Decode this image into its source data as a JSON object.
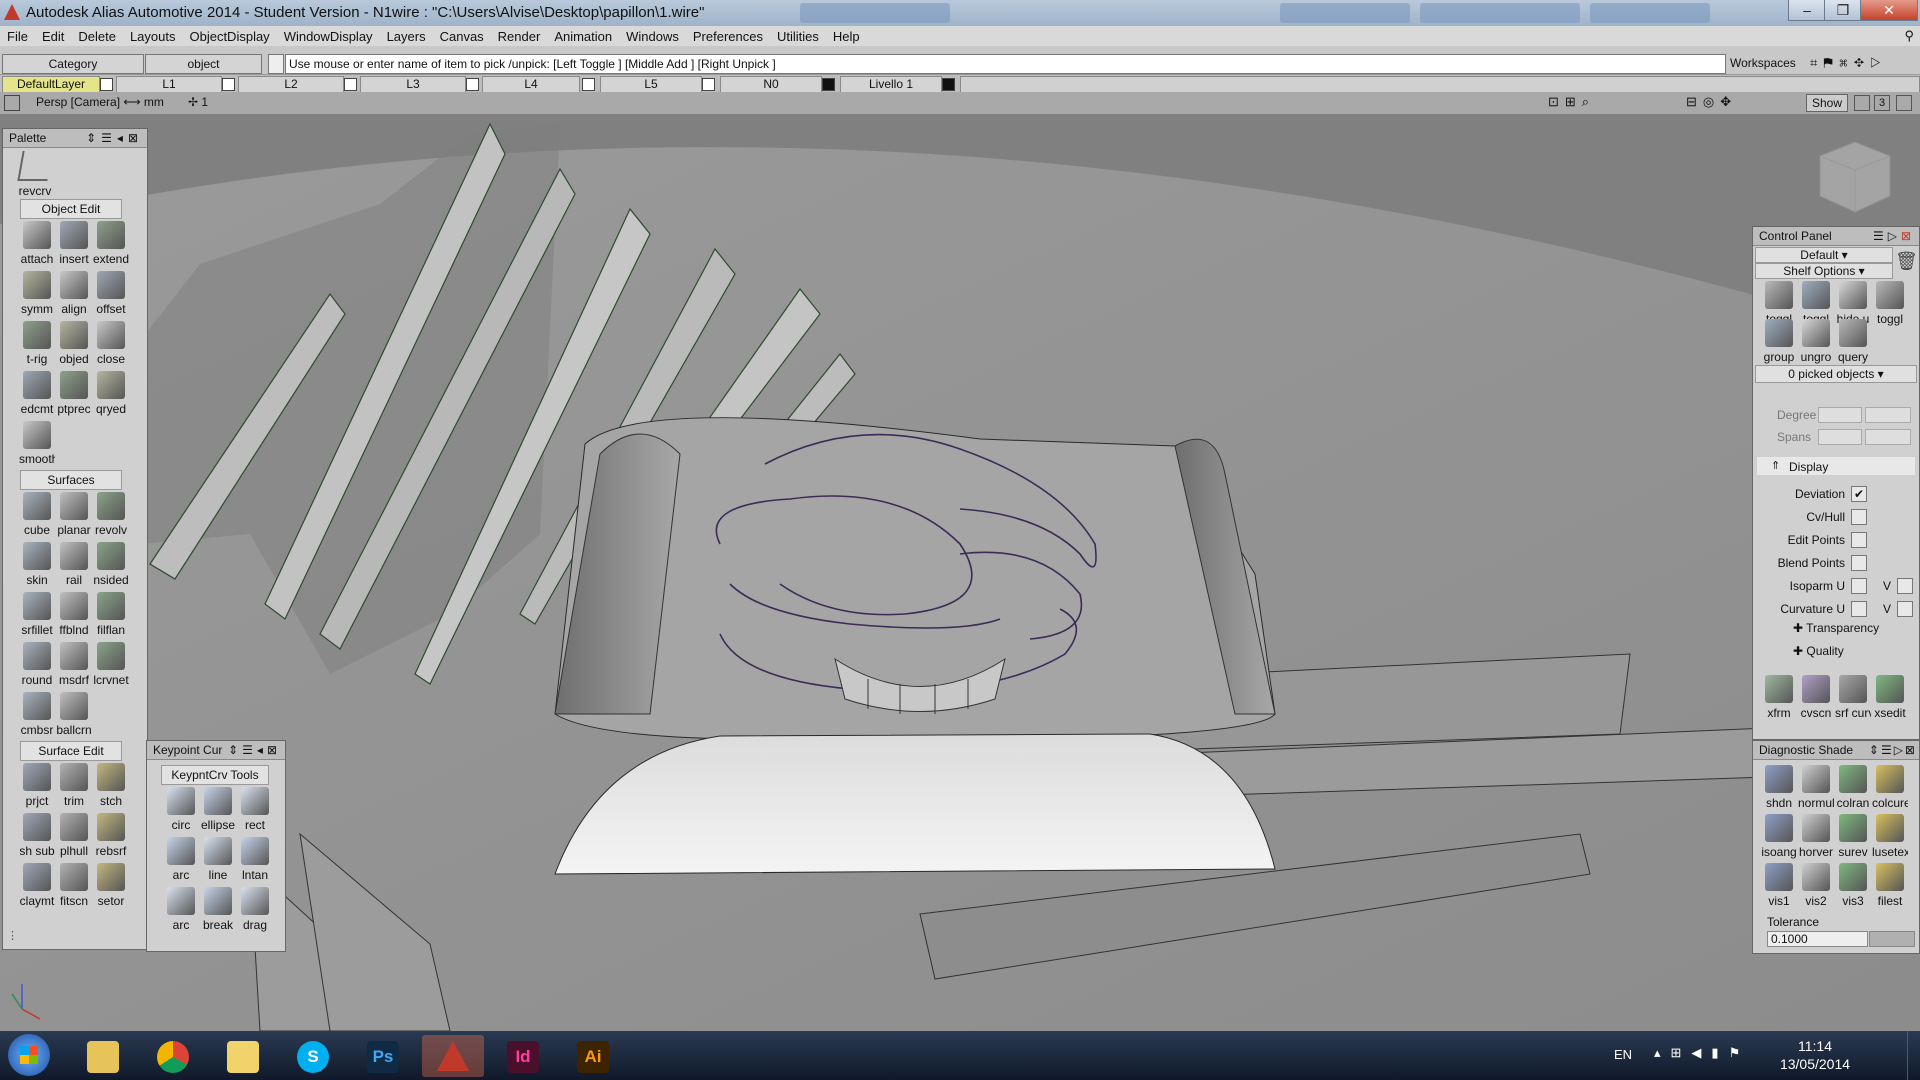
{
  "window": {
    "title": "Autodesk Alias Automotive 2014   - Student Version   - N1wire : \"C:\\Users\\Alvise\\Desktop\\papillon\\1.wire\""
  },
  "menu": [
    "File",
    "Edit",
    "Delete",
    "Layouts",
    "ObjectDisplay",
    "WindowDisplay",
    "Layers",
    "Canvas",
    "Render",
    "Animation",
    "Windows",
    "Preferences",
    "Utilities",
    "Help"
  ],
  "pickbar": {
    "category": "Category",
    "object": "object",
    "prompt": "Use mouse or enter name of item to pick /unpick: [Left Toggle ] [Middle Add ] [Right Unpick ]",
    "workspaces": "Workspaces"
  },
  "layers": [
    "DefaultLayer",
    "L1",
    "L2",
    "L3",
    "L4",
    "L5",
    "N0",
    "Livello 1"
  ],
  "viewbar": {
    "camera": "Persp [Camera] ⟷ mm",
    "grid": "✢ 1",
    "show": "Show",
    "three": "3"
  },
  "palette": {
    "title": "Palette",
    "top_tool": "revcrv",
    "sections": {
      "object_edit": "Object Edit",
      "surfaces": "Surfaces",
      "surface_edit": "Surface Edit"
    },
    "object_edit_tools": [
      "attach",
      "insert",
      "extend",
      "symm",
      "align",
      "offset",
      "t-rig",
      "objed",
      "close",
      "edcmt",
      "ptprec",
      "qryed",
      "smooth"
    ],
    "surfaces_tools": [
      "cube",
      "planar",
      "revolv",
      "skin",
      "rail",
      "nsided",
      "srfillet",
      "ffblnd",
      "filflan",
      "round",
      "msdrf",
      "lcrvnet",
      "cmbsr",
      "ballcrn"
    ],
    "surface_edit_tools": [
      "prjct",
      "trim",
      "stch",
      "sh sub",
      "plhull",
      "rebsrf",
      "claymt",
      "fitscn",
      "setor"
    ]
  },
  "keypoint": {
    "title": "Keypoint Cur",
    "tab": "KeypntCrv Tools",
    "tools": [
      "circ",
      "ellipse",
      "rect",
      "arc",
      "line",
      "lntan",
      "arc",
      "break",
      "drag"
    ]
  },
  "control_panel": {
    "title": "Control Panel",
    "preset": "Default",
    "shelf_options": "Shelf Options",
    "shelf_tools": [
      "toggl",
      "toggl",
      "hide u",
      "toggl",
      "group",
      "ungro",
      "query"
    ],
    "picked": "0 picked objects",
    "degree_label": "Degree",
    "spans_label": "Spans",
    "display_section": "Display",
    "options": [
      {
        "label": "Deviation",
        "checked": true
      },
      {
        "label": "Cv/Hull",
        "checked": false
      },
      {
        "label": "Edit Points",
        "checked": false
      },
      {
        "label": "Blend Points",
        "checked": false
      },
      {
        "label": "Isoparm U",
        "checked": false
      },
      {
        "label": "Curvature U",
        "checked": false
      }
    ],
    "v_label": "V",
    "transparency": "Transparency",
    "quality": "Quality",
    "bottom_tools": [
      "xfrm",
      "cvscn",
      "srf curva",
      "xsedit"
    ]
  },
  "diagnostic": {
    "title": "Diagnostic Shade",
    "tools": [
      "shdn",
      "normul",
      "colran",
      "colcurev",
      "isoang",
      "horver",
      "surev",
      "lusetex",
      "vis1",
      "vis2",
      "vis3",
      "filest"
    ],
    "tolerance_label": "Tolerance",
    "tolerance_value": "0.1000"
  },
  "taskbar": {
    "apps": [
      "Explorer",
      "Chrome",
      "Folder",
      "Skype",
      "Photoshop",
      "Alias",
      "InDesign",
      "Illustrator"
    ],
    "app_labels": [
      "",
      "",
      "",
      "S",
      "Ps",
      "",
      "Id",
      "Ai"
    ],
    "lang": "EN",
    "time": "11:14",
    "date": "13/05/2014"
  },
  "colors": {
    "accent_alias": "#c0392b",
    "ps": "#0f2b44",
    "id": "#4a0f2a",
    "ai": "#3d2300",
    "skype": "#00aff0"
  }
}
